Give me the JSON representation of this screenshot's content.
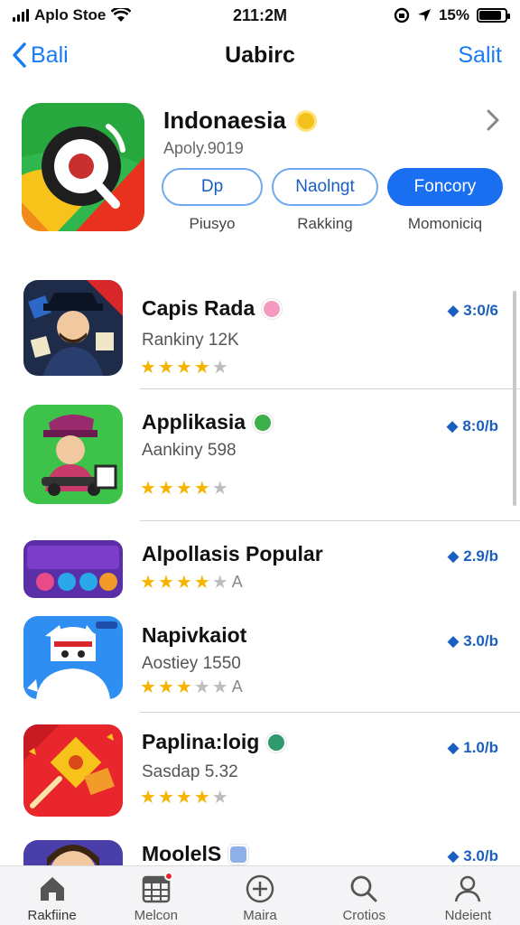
{
  "status_bar": {
    "carrier": "Aplo Stoe",
    "time": "211:2M",
    "battery": "15%",
    "battery_level": 0.85
  },
  "nav": {
    "back_label": "Bali",
    "title": "Uabirc",
    "right_label": "Salit"
  },
  "featured": {
    "name": "Indonaesia",
    "subtitle": "Apoly.9019",
    "pills": [
      {
        "label": "Dp",
        "caption": "Piusyo",
        "filled": false
      },
      {
        "label": "Naolngt",
        "caption": "Rakking",
        "filled": false
      },
      {
        "label": "Foncory",
        "caption": "Momoniciq",
        "filled": true
      }
    ]
  },
  "apps": [
    {
      "name": "Capis Rada",
      "subtitle": "Rankiny 12K",
      "rating": 3.5,
      "rating_suffix": "",
      "price": "◆ 3:0/6",
      "badge_color": "#f29ac0"
    },
    {
      "name": "Applikasia",
      "subtitle": "Aankiny 598",
      "rating": 4,
      "rating_suffix": "",
      "price": "◆ 8:0/b",
      "badge_color": "#3cb04a"
    },
    {
      "name": "Alpollasis Popular",
      "subtitle": "",
      "rating": 3.5,
      "rating_suffix": "A",
      "price": "◆ 2.9/b",
      "badge_color": ""
    },
    {
      "name": "Napivkaiot",
      "subtitle": "Aostiey 1550",
      "rating": 2.5,
      "rating_suffix": "A",
      "price": "◆ 3.0/b",
      "badge_color": ""
    },
    {
      "name": "Paplina:loig",
      "subtitle": "Sasdap 5.32",
      "rating": 3.5,
      "rating_suffix": "",
      "price": "◆ 1.0/b",
      "badge_color": "#2e9a6e"
    },
    {
      "name": "MoolelS",
      "subtitle": "",
      "rating": 0,
      "rating_suffix": "",
      "price": "◆ 3.0/b",
      "badge_color": "#8fb0e8"
    }
  ],
  "tabs": [
    {
      "label": "Rakfiine",
      "icon": "home-icon"
    },
    {
      "label": "Melcon",
      "icon": "calendar-grid-icon"
    },
    {
      "label": "Maira",
      "icon": "plus-circle-icon"
    },
    {
      "label": "Crotios",
      "icon": "search-icon"
    },
    {
      "label": "Ndeient",
      "icon": "person-icon"
    }
  ],
  "colors": {
    "accent": "#1a7cf2",
    "star": "#f4b400",
    "price": "#1a5fbf"
  }
}
